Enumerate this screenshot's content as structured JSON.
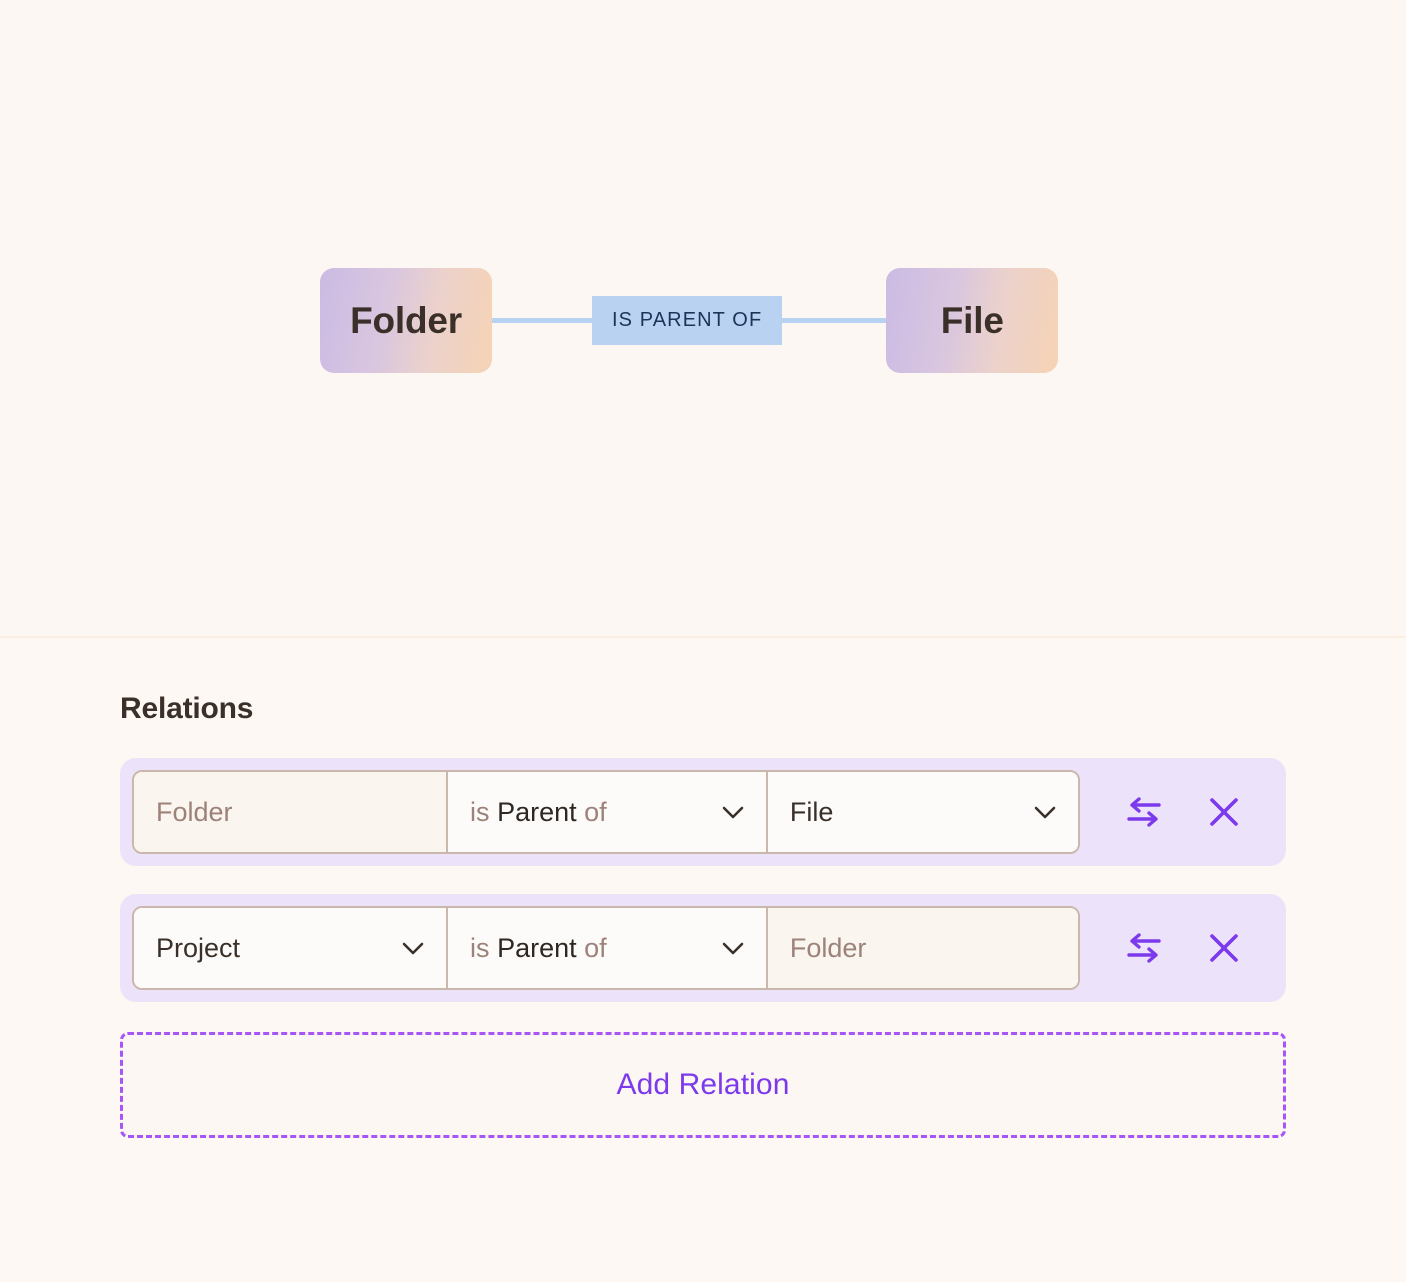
{
  "canvas": {
    "graph": {
      "source_node": {
        "label": "Folder"
      },
      "edge_label": "IS PARENT OF",
      "target_node": {
        "label": "File"
      }
    }
  },
  "panel": {
    "title": "Relations",
    "relations": [
      {
        "subject": {
          "value": "Folder",
          "is_placeholder": true,
          "has_chevron": false
        },
        "predicate": {
          "prefix": "is",
          "verb": "Parent",
          "suffix": "of",
          "has_chevron": true
        },
        "object": {
          "value": "File",
          "is_placeholder": false,
          "has_chevron": true
        },
        "swap_icon": "swap-arrows-icon",
        "delete_icon": "close-x-icon"
      },
      {
        "subject": {
          "value": "Project",
          "is_placeholder": false,
          "has_chevron": true
        },
        "predicate": {
          "prefix": "is",
          "verb": "Parent",
          "suffix": "of",
          "has_chevron": true
        },
        "object": {
          "value": "Folder",
          "is_placeholder": true,
          "has_chevron": false
        },
        "swap_icon": "swap-arrows-icon",
        "delete_icon": "close-x-icon"
      }
    ],
    "add_relation_label": "Add Relation"
  },
  "colors": {
    "canvas_background": "#fdf7f3",
    "panel_background": "#fdf8f4",
    "node_fill": "#f5f0ec",
    "node_text": "#3b3029",
    "edge_blue": "#b9d2f2",
    "edge_label_text": "#1b3558",
    "row_background": "#ece2fa",
    "field_border": "#cbb8ad",
    "placeholder_text": "#9c8279",
    "accent_purple": "#7c3aed",
    "add_relation_border": "#a855f7"
  }
}
